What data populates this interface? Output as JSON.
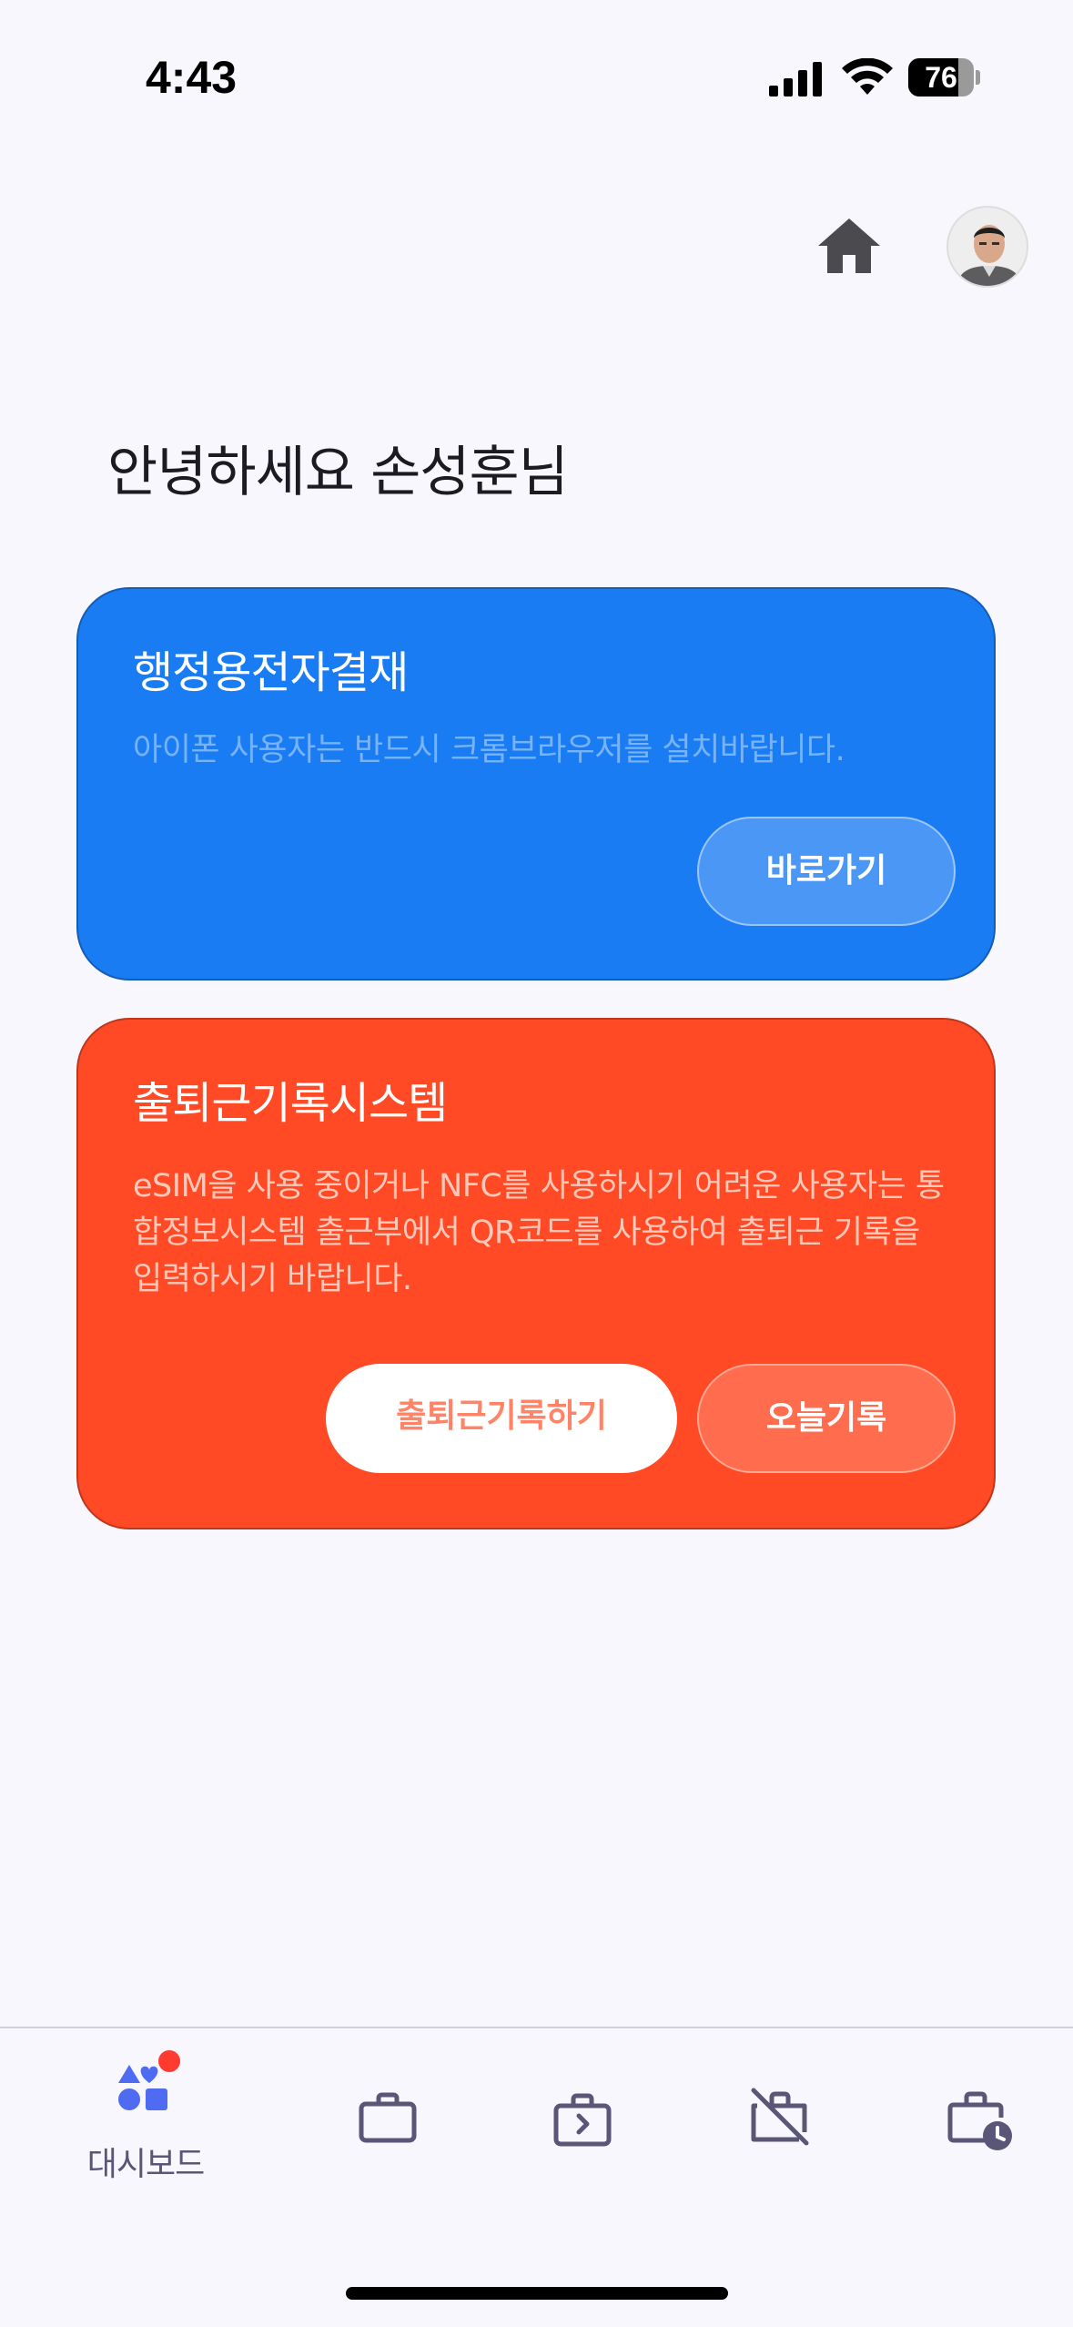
{
  "status_bar": {
    "time": "4:43",
    "battery_level": "76",
    "battery_fraction": 0.76
  },
  "header": {
    "home_icon": "home-icon",
    "avatar_icon": "user-avatar"
  },
  "greeting": "안녕하세요 손성훈님",
  "cards": {
    "approval": {
      "title": "행정용전자결재",
      "description": "아이폰 사용자는 반드시 크롬브라우저를 설치바랍니다.",
      "button": "바로가기",
      "color": "#1a7cf3"
    },
    "attendance": {
      "title": "출퇴근기록시스템",
      "description": "eSIM을 사용 중이거나 NFC를 사용하시기 어려운 사용자는 통합정보시스템 출근부에서 QR코드를 사용하여 출퇴근 기록을 입력하시기 바랍니다.",
      "button_record": "출퇴근기록하기",
      "button_today": "오늘기록",
      "color": "#ff4a25"
    }
  },
  "tabs": [
    {
      "label": "대시보드",
      "icon": "shapes-dashboard-icon",
      "active": true
    },
    {
      "label": "",
      "icon": "briefcase-icon"
    },
    {
      "label": "",
      "icon": "briefcase-arrow-icon"
    },
    {
      "label": "",
      "icon": "briefcase-off-icon"
    },
    {
      "label": "",
      "icon": "briefcase-clock-icon"
    }
  ]
}
